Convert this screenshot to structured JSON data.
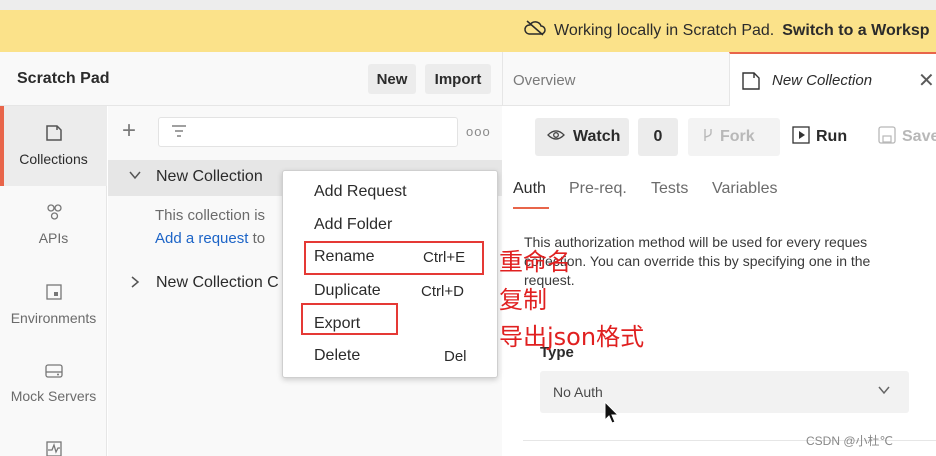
{
  "banner": {
    "text": "Working locally in Scratch Pad.",
    "link": "Switch to a Worksp",
    "icon": "cloud-off-icon"
  },
  "sidebar": {
    "title": "Scratch Pad",
    "new_label": "New",
    "import_label": "Import",
    "nav": [
      {
        "label": "Collections",
        "icon": "collections-icon"
      },
      {
        "label": "APIs",
        "icon": "apis-icon"
      },
      {
        "label": "Environments",
        "icon": "environments-icon"
      },
      {
        "label": "Mock Servers",
        "icon": "mock-servers-icon"
      }
    ],
    "collections": [
      {
        "name": "New Collection"
      },
      {
        "name": "New Collection C"
      }
    ],
    "empty_text": "This collection is",
    "add_request_link": "Add a request",
    "add_request_rest": "to"
  },
  "context_menu": {
    "items": [
      {
        "label": "Add Request",
        "shortcut": ""
      },
      {
        "label": "Add Folder",
        "shortcut": ""
      },
      {
        "label": "Rename",
        "shortcut": "Ctrl+E"
      },
      {
        "label": "Duplicate",
        "shortcut": "Ctrl+D"
      },
      {
        "label": "Export",
        "shortcut": ""
      },
      {
        "label": "Delete",
        "shortcut": "Del"
      }
    ]
  },
  "annotations": {
    "rename": "重命名",
    "duplicate": "复制",
    "export": "导出json格式",
    "color": "#e53935"
  },
  "main": {
    "tab_overview": "Overview",
    "tab_active": "New Collection",
    "watch_label": "Watch",
    "watch_count": "0",
    "fork_label": "Fork",
    "run_label": "Run",
    "save_label": "Save",
    "panel_tabs": [
      "Auth",
      "Pre-req.",
      "Tests",
      "Variables"
    ],
    "auth_description_1": "This authorization method will be used for every reques",
    "auth_description_2": "collection. You can override this by specifying one in the",
    "auth_description_3": "request.",
    "type_label": "Type",
    "type_value": "No Auth"
  },
  "watermark": "CSDN @小杜℃",
  "colors": {
    "accent": "#e8654a",
    "banner": "#fbe28a",
    "link": "#1c64c7"
  }
}
